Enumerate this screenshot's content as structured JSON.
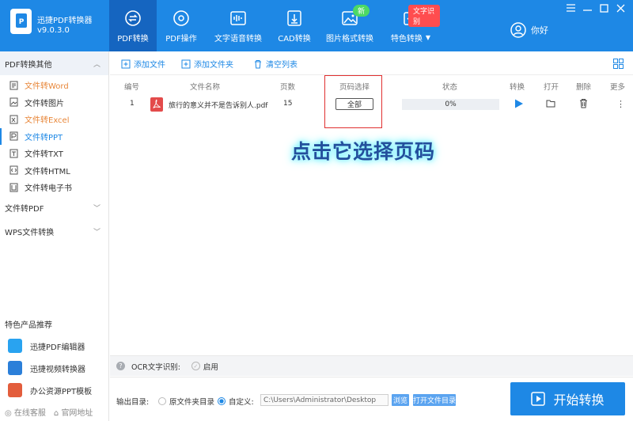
{
  "app": {
    "title": "迅捷PDF转换器",
    "version": "v9.0.3.0"
  },
  "nav": [
    {
      "label": "PDF转换",
      "icon": "convert-icon",
      "active": true
    },
    {
      "label": "PDF操作",
      "icon": "pdf-operate-icon"
    },
    {
      "label": "文字语音转换",
      "icon": "audio-wave-icon"
    },
    {
      "label": "CAD转换",
      "icon": "cad-icon"
    },
    {
      "label": "图片格式转换",
      "icon": "image-icon",
      "badge": "新"
    },
    {
      "label": "特色转换",
      "icon": "special-icon",
      "badge": "文字识别"
    }
  ],
  "user": {
    "label": "你好"
  },
  "sidebar": {
    "section1": "PDF转换其他",
    "items": [
      "文件转Word",
      "文件转图片",
      "文件转Excel",
      "文件转PPT",
      "文件转TXT",
      "文件转HTML",
      "文件转电子书"
    ],
    "section2": "文件转PDF",
    "section3": "WPS文件转换",
    "featured_title": "特色产品推荐",
    "featured": [
      "迅捷PDF编辑器",
      "迅捷视频转换器",
      "办公资源PPT模板"
    ],
    "links": [
      "在线客服",
      "官网地址"
    ]
  },
  "toolbar": {
    "add_file": "添加文件",
    "add_folder": "添加文件夹",
    "clear": "清空列表"
  },
  "table": {
    "headers": [
      "编号",
      "文件名称",
      "页数",
      "页码选择",
      "状态",
      "转换",
      "打开",
      "删除",
      "更多"
    ],
    "rows": [
      {
        "no": "1",
        "name": "旅行的意义并不是告诉别人.pdf",
        "pages": "15",
        "page_select": "全部",
        "progress": "0%"
      }
    ]
  },
  "overlay_text": "点击它选择页码",
  "ocr": {
    "label": "OCR文字识别:",
    "enable": "启用"
  },
  "output": {
    "label": "输出目录:",
    "opt_original": "原文件夹目录",
    "opt_custom": "自定义:",
    "path": "C:\\Users\\Administrator\\Desktop",
    "browse": "浏览",
    "open_dir": "打开文件目录"
  },
  "start_button": "开始转换",
  "colors": {
    "primary": "#1e88e5",
    "active_nav": "#1565c0",
    "highlight_red": "#e03030",
    "orange": "#e8873a"
  }
}
